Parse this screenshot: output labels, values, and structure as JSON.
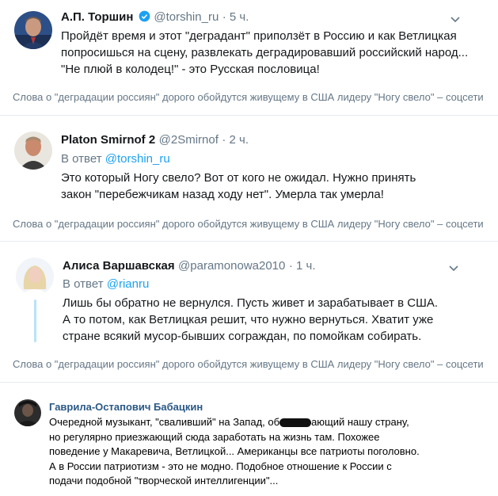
{
  "tweets": [
    {
      "name": "А.П. Торшин",
      "handle": "@torshin_ru",
      "time": "· 5 ч.",
      "text": "Пройдёт время и этот \"деградант\" приползёт в Россию и как Ветлицкая попросишься на сцену, развлекать деградировавший российский народ... \"Не плюй в колодец!\" - это Русская пословица!",
      "verified": true
    },
    {
      "name": "Platon Smirnof 2",
      "handle": "@2Smirnof",
      "time": "· 2 ч.",
      "reply_prefix": "В ответ",
      "reply_to": "@torshin_ru",
      "text": "Это который Ногу свело? Вот от кого не ожидал. Нужно принять закон \"перебежчикам назад ходу нет\".  Умерла так умерла!"
    },
    {
      "name": "Алиса Варшавская",
      "handle": "@paramonowa2010",
      "time": "· 1 ч.",
      "reply_prefix": "В ответ",
      "reply_to": "@rianru",
      "text": "Лишь бы обратно не вернулся. Пусть живет и зарабатывает в США. А то потом, как Ветлицкая решит, что нужно вернуться. Хватит уже стране всякий мусор-бывших сограждан, по помойкам собирать."
    }
  ],
  "caption": "Слова о \"деградации россиян\" дорого обойдутся живущему в США лидеру \"Ногу свело\" – соцсети",
  "vk_post": {
    "name": "Гаврила-Остапович Бабацкин",
    "text_before": "Очередной музыкант, \"сваливший\" на Запад, об",
    "text_after": "ающий нашу страну, но регулярно приезжающий сюда заработать на жизнь там. Похожее поведение у Макаревича, Ветлицкой... Американцы все патриоты поголовно. А в России патриотизм - это не модно. Подобное отношение к России с подачи подобной \"творческой интеллигенции\"..."
  },
  "icons": {
    "verified": "verified-badge-icon",
    "menu": "chevron-down-icon"
  },
  "colors": {
    "link": "#1da1f2",
    "muted": "#657786",
    "vk_name": "#2a5885"
  }
}
